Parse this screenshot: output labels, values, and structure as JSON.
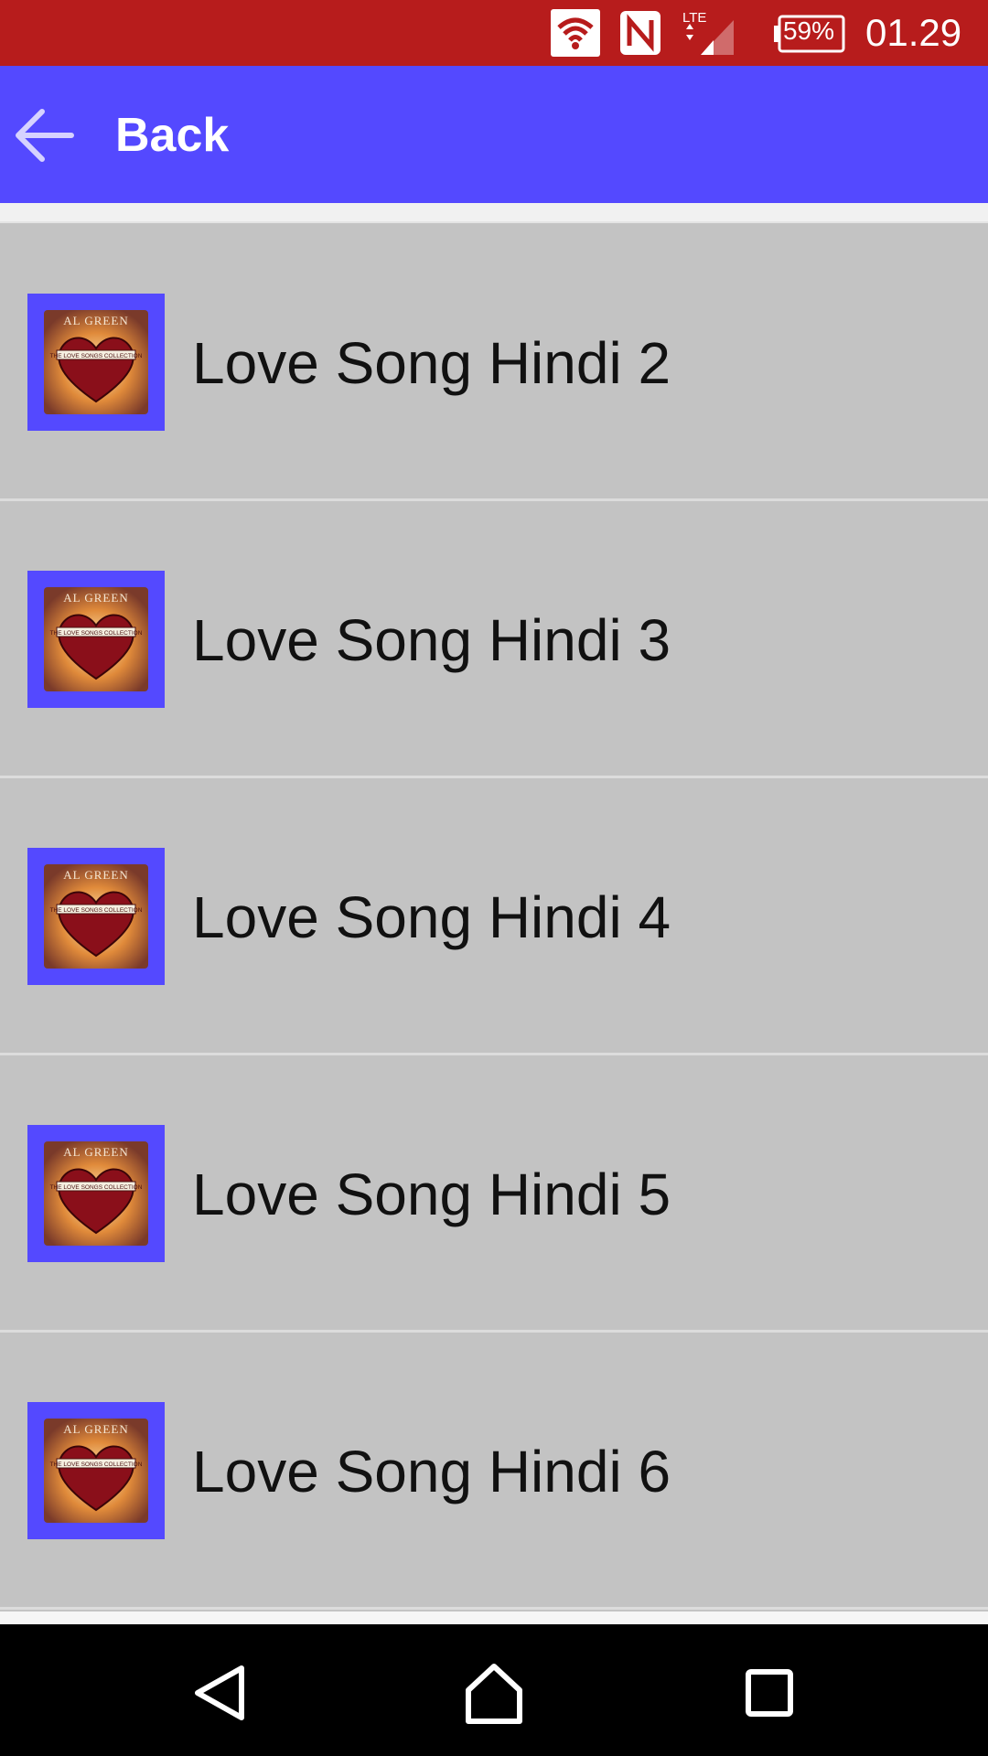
{
  "status_bar": {
    "battery": "59%",
    "time": "01.29",
    "network": "LTE",
    "icons": [
      "wifi-icon",
      "nfc-icon",
      "lte-signal-icon",
      "battery-icon"
    ],
    "background": "#b71c1c"
  },
  "app_bar": {
    "back_label": "Back",
    "background": "#5449ff",
    "icon": "back-arrow-icon"
  },
  "songs": [
    {
      "title": "Love Song Hindi 2",
      "album_text": "AL GREEN",
      "album_subtext": "THE LOVE SONGS COLLECTION"
    },
    {
      "title": "Love Song Hindi 3",
      "album_text": "AL GREEN",
      "album_subtext": "THE LOVE SONGS COLLECTION"
    },
    {
      "title": "Love Song Hindi 4",
      "album_text": "AL GREEN",
      "album_subtext": "THE LOVE SONGS COLLECTION"
    },
    {
      "title": "Love Song Hindi 5",
      "album_text": "AL GREEN",
      "album_subtext": "THE LOVE SONGS COLLECTION"
    },
    {
      "title": "Love Song Hindi 6",
      "album_text": "AL GREEN",
      "album_subtext": "THE LOVE SONGS COLLECTION"
    }
  ],
  "nav_bar": {
    "icons": [
      "nav-back-icon",
      "nav-home-icon",
      "nav-recent-apps-icon"
    ]
  }
}
